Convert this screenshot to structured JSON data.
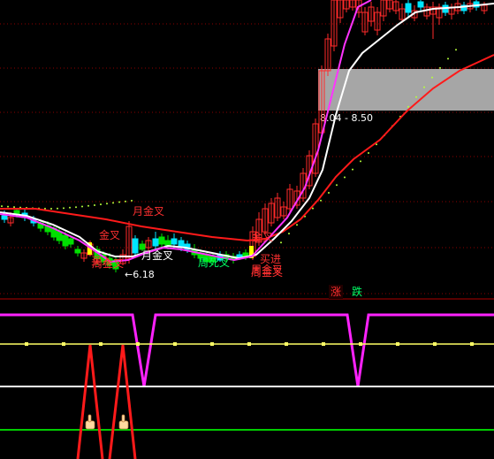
{
  "colors": {
    "background": "#000000",
    "grid": "#8b0000",
    "up_candle": "#ff2a2a",
    "down_candle": "#00e000",
    "flat_candle": "#00e5ff",
    "line_fast": "#ff33ff",
    "line_mid": "#ffffff",
    "line_slow": "#ff1a1a",
    "dots": "#b6ff3a",
    "band": "#a6a6a6",
    "sub_magenta": "#ff22ff",
    "sub_yellow": "#ffff66",
    "sub_white": "#ffffff",
    "sub_red": "#ff1a1a",
    "sub_green": "#00cc00",
    "label_red": "#ff3030",
    "label_green": "#00ff66",
    "label_white": "#ffffff"
  },
  "chart_data": {
    "type": "candlestick",
    "title": "",
    "price_band": {
      "label": "8.04 - 8.50",
      "low": 8.04,
      "high": 8.5
    },
    "low_marker": {
      "label": "←6.18",
      "value": 6.18
    },
    "annotations": [
      {
        "text": "月金叉",
        "color": "red"
      },
      {
        "text": "买入",
        "color": "red"
      },
      {
        "text": "金叉",
        "color": "red"
      },
      {
        "text": "周金叉",
        "color": "red"
      },
      {
        "text": "月金叉",
        "color": "white"
      },
      {
        "text": "周死叉",
        "color": "green"
      },
      {
        "text": "周金叉",
        "color": "red"
      },
      {
        "text": "买进",
        "color": "red"
      },
      {
        "text": "周金叉",
        "color": "red"
      },
      {
        "text": "金叉",
        "color": "red"
      }
    ],
    "sub_panel": {
      "markers": [
        {
          "text": "涨",
          "color": "red"
        },
        {
          "text": "跌",
          "color": "green"
        }
      ],
      "signal_icon": "pointing-hand-icon",
      "signal_count": 2
    }
  }
}
